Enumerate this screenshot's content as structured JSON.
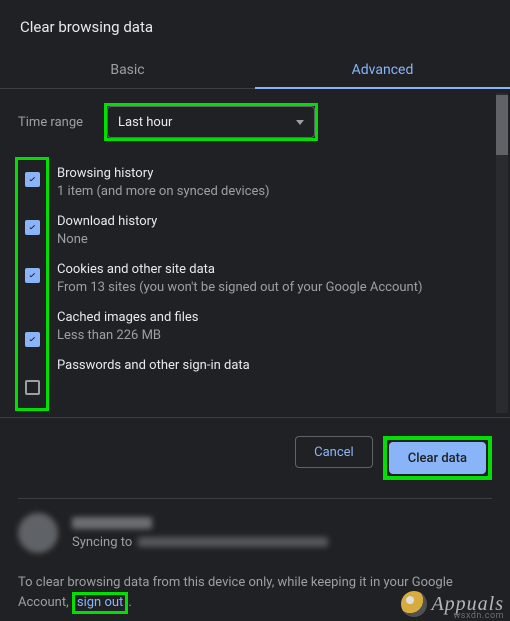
{
  "dialog": {
    "title": "Clear browsing data",
    "tabs": {
      "basic": "Basic",
      "advanced": "Advanced",
      "active": "advanced"
    },
    "time_range": {
      "label": "Time range",
      "value": "Last hour"
    },
    "items": [
      {
        "label": "Browsing history",
        "sub": "1 item (and more on synced devices)",
        "checked": true
      },
      {
        "label": "Download history",
        "sub": "None",
        "checked": true
      },
      {
        "label": "Cookies and other site data",
        "sub": "From 13 sites (you won't be signed out of your Google Account)",
        "checked": true
      },
      {
        "label": "Cached images and files",
        "sub": "Less than 226 MB",
        "checked": true
      },
      {
        "label": "Passwords and other sign-in data",
        "sub": "",
        "checked": false
      }
    ],
    "buttons": {
      "cancel": "Cancel",
      "confirm": "Clear data"
    }
  },
  "account": {
    "syncing_label": "Syncing to"
  },
  "footer": {
    "pre": "To clear browsing data from this device only, while keeping it in your Google Account, ",
    "link": "sign out",
    "post": "."
  },
  "watermark": {
    "text": "Appuals",
    "sub": "wsxdn.com"
  },
  "highlight_color": "#00e000"
}
